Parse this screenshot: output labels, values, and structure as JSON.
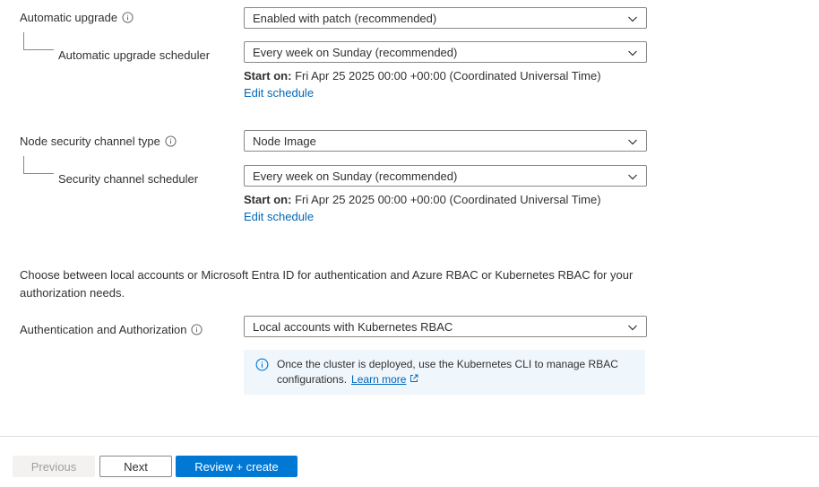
{
  "upgrade": {
    "automatic_upgrade_label": "Automatic upgrade",
    "automatic_upgrade_value": "Enabled with patch (recommended)",
    "scheduler_label": "Automatic upgrade scheduler",
    "scheduler_value": "Every week on Sunday (recommended)",
    "start_on_label": "Start on:",
    "start_on_value": "Fri Apr 25 2025 00:00 +00:00 (Coordinated Universal Time)",
    "edit_schedule": "Edit schedule"
  },
  "security": {
    "channel_type_label": "Node security channel type",
    "channel_type_value": "Node Image",
    "scheduler_label": "Security channel scheduler",
    "scheduler_value": "Every week on Sunday (recommended)",
    "start_on_label": "Start on:",
    "start_on_value": "Fri Apr 25 2025 00:00 +00:00 (Coordinated Universal Time)",
    "edit_schedule": "Edit schedule"
  },
  "auth": {
    "description": "Choose between local accounts or Microsoft Entra ID for authentication and Azure RBAC or Kubernetes RBAC for your authorization needs.",
    "label": "Authentication and Authorization",
    "value": "Local accounts with Kubernetes RBAC",
    "info_text": "Once the cluster is deployed, use the Kubernetes CLI to manage RBAC configurations.",
    "learn_more": "Learn more"
  },
  "footer": {
    "previous_label": "Previous",
    "next_label": "Next",
    "review_label": "Review + create"
  },
  "colors": {
    "accent": "#0078d4",
    "link": "#0067b8",
    "info_bg": "#eff6fc"
  },
  "icons": [
    "info-icon",
    "chevron-down-icon",
    "external-link-icon"
  ]
}
